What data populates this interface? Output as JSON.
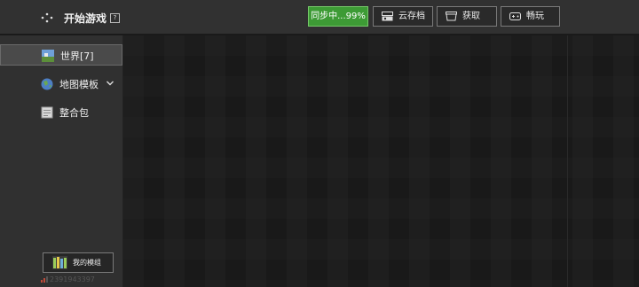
{
  "header": {
    "title": "开始游戏",
    "help": "?",
    "sync_label": "同步中...99%",
    "cloud_label": "云存档",
    "get_label": "获取",
    "play_label": "畅玩"
  },
  "sidebar": {
    "items": [
      {
        "label": "世界[7]",
        "icon": "world-icon",
        "active": true
      },
      {
        "label": "地图模板",
        "icon": "globe-icon",
        "active": false
      },
      {
        "label": "整合包",
        "icon": "package-icon",
        "active": false
      }
    ],
    "mods_button": "我的模组",
    "user_id": "2391943397"
  },
  "colors": {
    "sync_green": "#3d9b35",
    "background": "#1c1c1c",
    "sidebar": "#303030",
    "topbar": "#313131"
  }
}
